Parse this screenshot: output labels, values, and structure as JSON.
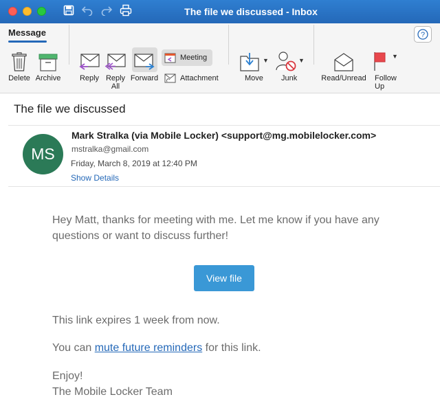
{
  "window": {
    "title": "The file we discussed - Inbox"
  },
  "ribbon": {
    "tab": "Message",
    "buttons": {
      "delete": "Delete",
      "archive": "Archive",
      "reply": "Reply",
      "reply_all": "Reply\nAll",
      "forward": "Forward",
      "meeting": "Meeting",
      "attachment": "Attachment",
      "move": "Move",
      "junk": "Junk",
      "read_unread": "Read/Unread",
      "follow_up": "Follow\nUp"
    }
  },
  "message": {
    "subject": "The file we discussed",
    "avatar_initials": "MS",
    "avatar_color": "#2b7a57",
    "sender": "Mark Stralka (via Mobile Locker) <support@mg.mobilelocker.com>",
    "email": "mstralka@gmail.com",
    "date": "Friday, March 8, 2019 at 12:40 PM",
    "show_details": "Show Details"
  },
  "body": {
    "paragraph1": "Hey Matt, thanks for meeting with me. Let me know if you have any questions or want to discuss further!",
    "view_button": "View file",
    "paragraph2": "This link expires 1 week from now.",
    "paragraph3_prefix": "You can ",
    "paragraph3_link": "mute future reminders",
    "paragraph3_suffix": " for this link.",
    "closing": "Enjoy!",
    "signature": "The Mobile Locker Team"
  },
  "colors": {
    "titlebar": "#2468b8",
    "accent": "#2468b8",
    "button": "#3a98d6"
  }
}
